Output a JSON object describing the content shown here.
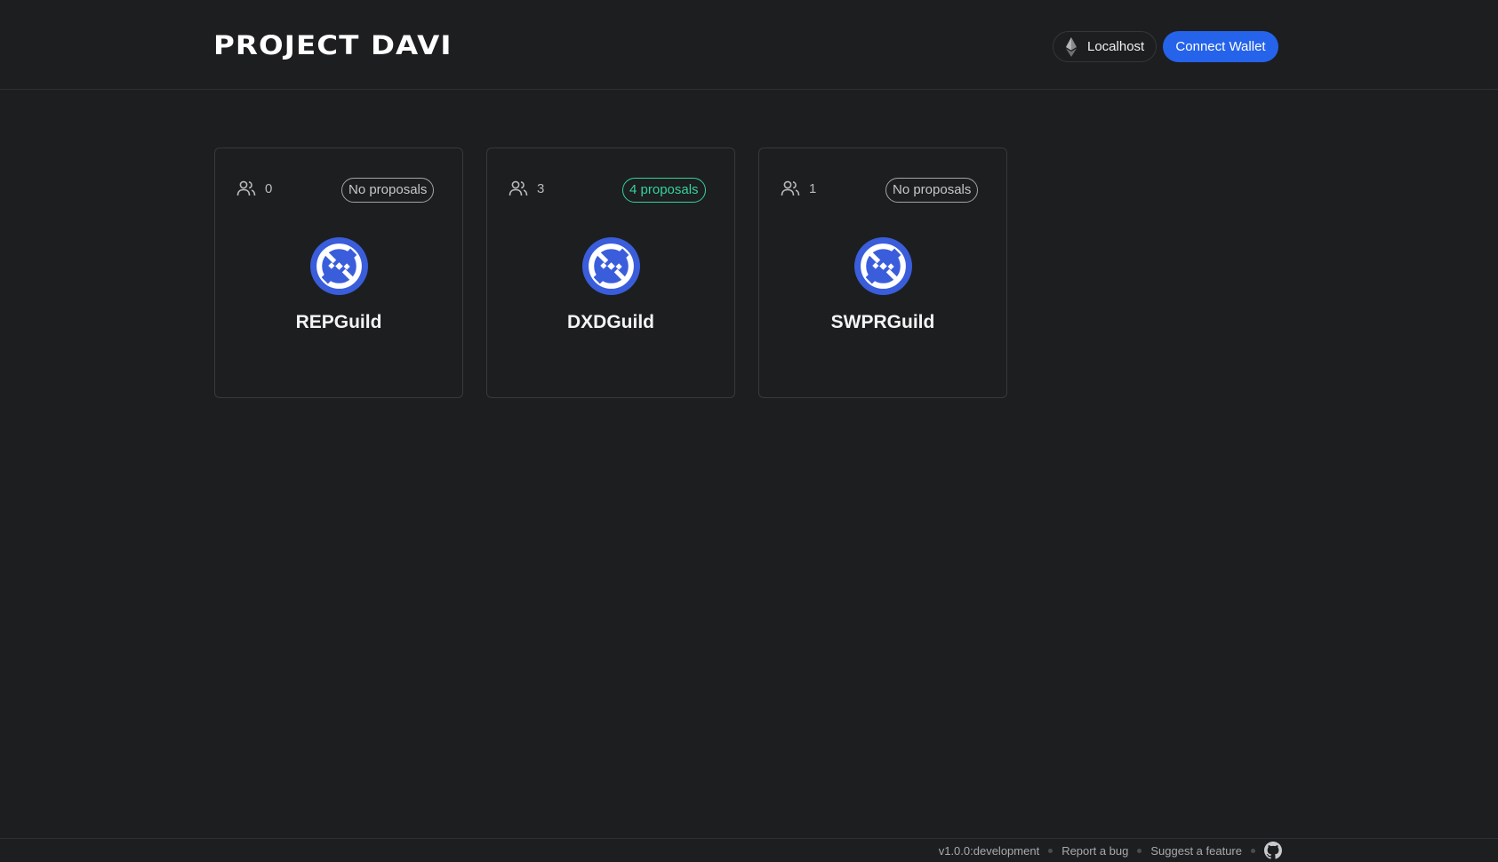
{
  "header": {
    "title": "PROJECT DAVI",
    "network_label": "Localhost",
    "connect_label": "Connect Wallet"
  },
  "guilds": [
    {
      "name": "REPGuild",
      "members": "0",
      "proposals": "No proposals",
      "active": false
    },
    {
      "name": "DXDGuild",
      "members": "3",
      "proposals": "4 proposals",
      "active": true
    },
    {
      "name": "SWPRGuild",
      "members": "1",
      "proposals": "No proposals",
      "active": false
    }
  ],
  "footer": {
    "version": "v1.0.0:development",
    "report_bug": "Report a bug",
    "suggest_feature": "Suggest a feature"
  },
  "colors": {
    "background": "#1d1e20",
    "accent": "#2563eb",
    "active_badge": "#34d399",
    "emblem": "#3a5ddb"
  }
}
